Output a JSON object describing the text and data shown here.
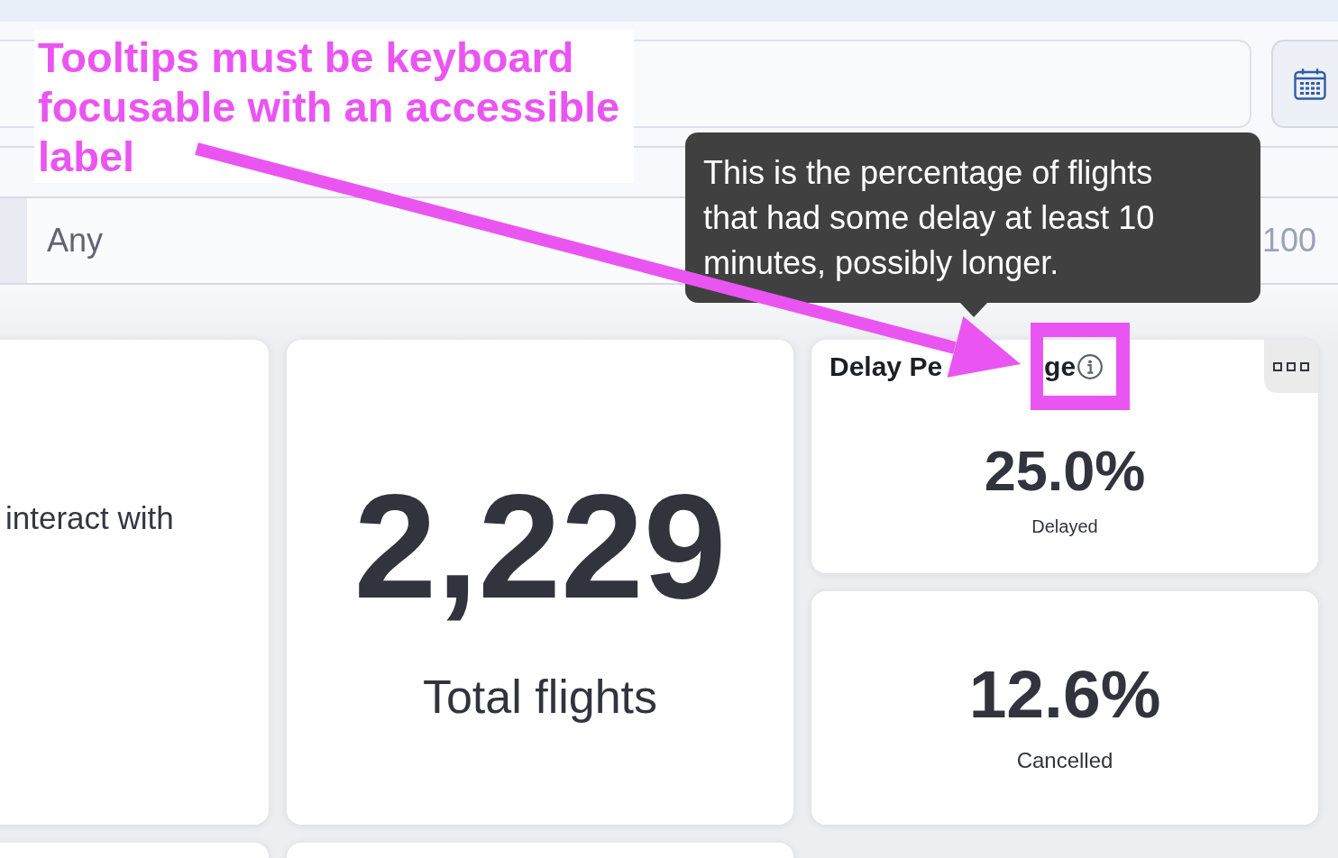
{
  "annotation": {
    "text": "Tooltips must be keyboard focusable with an accessible label"
  },
  "filters": {
    "range": {
      "min": {
        "value": "Any"
      },
      "max": {
        "placeholder": "100"
      }
    }
  },
  "tooltip": {
    "text": "This is the percentage of flights that had some delay at least 10 minutes, possibly longer."
  },
  "cards": [
    {
      "kind": "text",
      "text": "interact with"
    },
    {
      "kind": "big_number",
      "value": "2,229",
      "label": "Total flights"
    },
    {
      "kind": "metric",
      "title_fragments": [
        "Delay Pe",
        "ge"
      ],
      "value": "25.0%",
      "label": "Delayed"
    },
    {
      "kind": "metric",
      "value": "12.6%",
      "label": "Cancelled"
    },
    {
      "kind": "blank"
    },
    {
      "kind": "blank"
    }
  ]
}
